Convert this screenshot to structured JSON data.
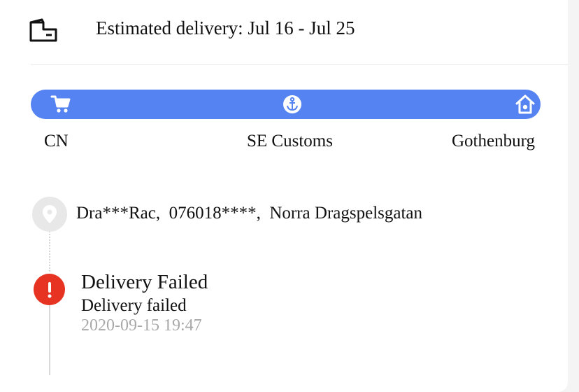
{
  "header": {
    "icon": "delivery-truck-icon",
    "estimated_delivery": "Estimated delivery: Jul 16 - Jul 25"
  },
  "progress": {
    "color": "#5583f2",
    "stages": [
      {
        "icon": "cart-icon",
        "label": "CN"
      },
      {
        "icon": "anchor-icon",
        "label": "SE Customs"
      },
      {
        "icon": "home-icon",
        "label": "Gothenburg"
      }
    ]
  },
  "address": {
    "icon": "location-pin-icon",
    "text": "Dra***Rac,  076018****,  Norra Dragspelsgatan"
  },
  "events": [
    {
      "icon": "alert-icon",
      "status_color": "#e63322",
      "title": "Delivery Failed",
      "description": "Delivery failed",
      "time": "2020-09-15 19:47"
    }
  ]
}
